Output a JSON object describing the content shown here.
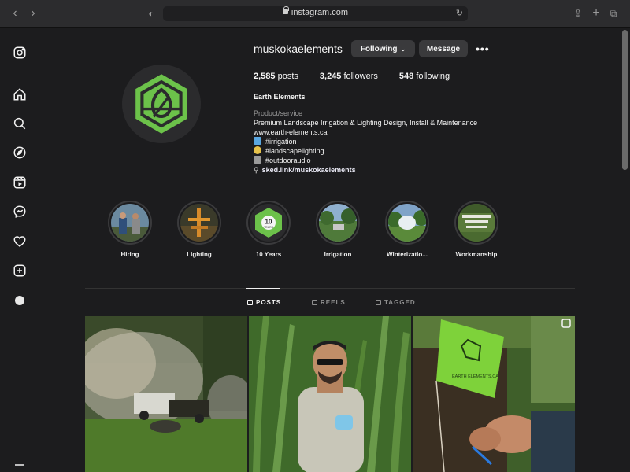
{
  "browser": {
    "url": "instagram.com"
  },
  "profile": {
    "username": "muskokaelements",
    "following_label": "Following",
    "message_label": "Message",
    "more_label": "•••",
    "stats": {
      "posts_count": "2,585",
      "posts_label": "posts",
      "followers_count": "3,245",
      "followers_label": "followers",
      "following_count": "548",
      "following_label": "following"
    },
    "bio": {
      "name": "Earth Elements",
      "category": "Product/service",
      "description": "Premium Landscape Irrigation & Lighting Design, Install & Maintenance",
      "website": "www.earth-elements.ca",
      "tag1": "#irrigation",
      "tag2": "#landscapelighting",
      "tag3": "#outdooraudio",
      "link": "sked.link/muskokaelements"
    }
  },
  "highlights": [
    {
      "label": "Hiring"
    },
    {
      "label": "Lighting"
    },
    {
      "label": "10 Years",
      "badge_top": "10",
      "badge_sub": "YEARS"
    },
    {
      "label": "Irrigation"
    },
    {
      "label": "Winterizatio..."
    },
    {
      "label": "Workmanship"
    }
  ],
  "tabs": {
    "posts": "POSTS",
    "reels": "REELS",
    "tagged": "TAGGED"
  },
  "post3": {
    "flag_text": "EARTH ELEMENTS.CA"
  },
  "colors": {
    "brand_green": "#6cc24a",
    "background": "#1c1c1e"
  }
}
